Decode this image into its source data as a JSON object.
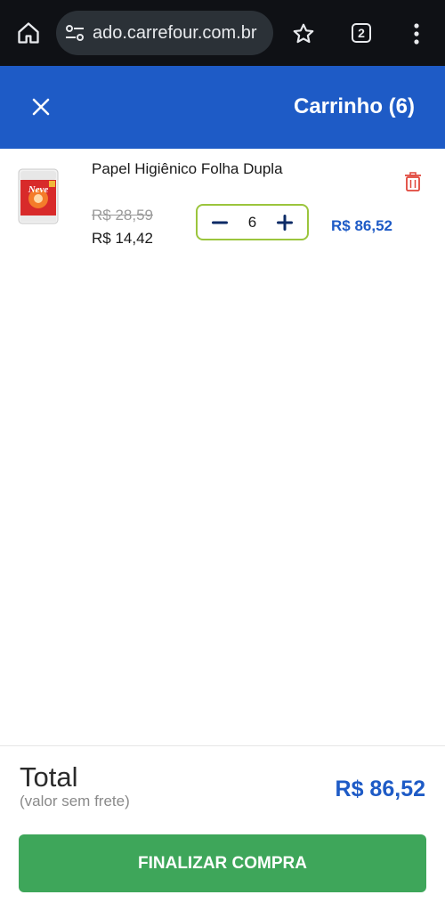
{
  "browser": {
    "url": "ado.carrefour.com.br",
    "tab_count": "2"
  },
  "header": {
    "title": "Carrinho (6)"
  },
  "cart": {
    "items": [
      {
        "name": "Papel Higiênico Folha Dupla",
        "brand_logo": "Neve",
        "old_price": "R$ 28,59",
        "price": "R$ 14,42",
        "quantity": "6",
        "line_total": "R$ 86,52"
      }
    ]
  },
  "footer": {
    "total_label": "Total",
    "total_sublabel": "(valor sem frete)",
    "total_value": "R$ 86,52",
    "checkout_label": "FINALIZAR COMPRA"
  },
  "colors": {
    "header_blue": "#1e5bc6",
    "checkout_green": "#3ea65a",
    "stepper_border": "#9bc53d",
    "delete_red": "#e0453a"
  },
  "icons": [
    "home-icon",
    "site-settings-icon",
    "star-icon",
    "tab-switcher-icon",
    "more-vert-icon",
    "close-icon",
    "trash-icon",
    "minus-icon",
    "plus-icon"
  ]
}
